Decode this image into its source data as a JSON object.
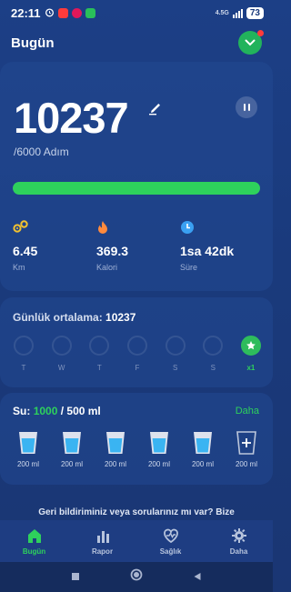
{
  "status_bar": {
    "time": "22:11",
    "battery": "73",
    "network": "4.5G",
    "icons": [
      "alarm-icon",
      "youtube-icon",
      "pinterest-icon",
      "whatsapp-icon"
    ]
  },
  "header": {
    "title": "Bugün",
    "badge_icon": "chevron-down-icon"
  },
  "steps": {
    "value": "10237",
    "goal_text": "/6000 Adım",
    "progress": 1.0,
    "edit_icon": "pencil-icon",
    "pause_icon": "pause-icon"
  },
  "stats": [
    {
      "icon": "distance-icon",
      "value": "6.45",
      "label": "Km"
    },
    {
      "icon": "flame-icon",
      "value": "369.3",
      "label": "Kalori"
    },
    {
      "icon": "clock-icon",
      "value": "1sa 42dk",
      "label": "Süre"
    }
  ],
  "weekly": {
    "avg_label": "Günlük ortalama:",
    "avg_value": "10237",
    "days": [
      {
        "label": "T",
        "active": false
      },
      {
        "label": "W",
        "active": false
      },
      {
        "label": "T",
        "active": false
      },
      {
        "label": "F",
        "active": false
      },
      {
        "label": "S",
        "active": false
      },
      {
        "label": "S",
        "active": false
      },
      {
        "label": "x1",
        "active": true
      }
    ]
  },
  "water": {
    "label": "Su:",
    "current": "1000",
    "target": " / 500 ml",
    "more": "Daha",
    "cups": [
      {
        "label": "200 ml",
        "filled": true
      },
      {
        "label": "200 ml",
        "filled": true
      },
      {
        "label": "200 ml",
        "filled": true
      },
      {
        "label": "200 ml",
        "filled": true
      },
      {
        "label": "200 ml",
        "filled": true
      },
      {
        "label": "200 ml",
        "filled": false
      }
    ]
  },
  "feedback": "Geri bildiriminiz veya sorularınız mı var? Bize",
  "tabs": [
    {
      "label": "Bugün",
      "icon": "home-icon",
      "active": true
    },
    {
      "label": "Rapor",
      "icon": "bar-chart-icon",
      "active": false
    },
    {
      "label": "Sağlık",
      "icon": "heart-pulse-icon",
      "active": false
    },
    {
      "label": "Daha",
      "icon": "gear-icon",
      "active": false
    }
  ],
  "colors": {
    "accent": "#2ed15c",
    "background": "#1c3f86",
    "water": "#3ab4f2",
    "flame": "#ff8a3d",
    "distance": "#f2c230",
    "clock": "#3aa0f2"
  }
}
